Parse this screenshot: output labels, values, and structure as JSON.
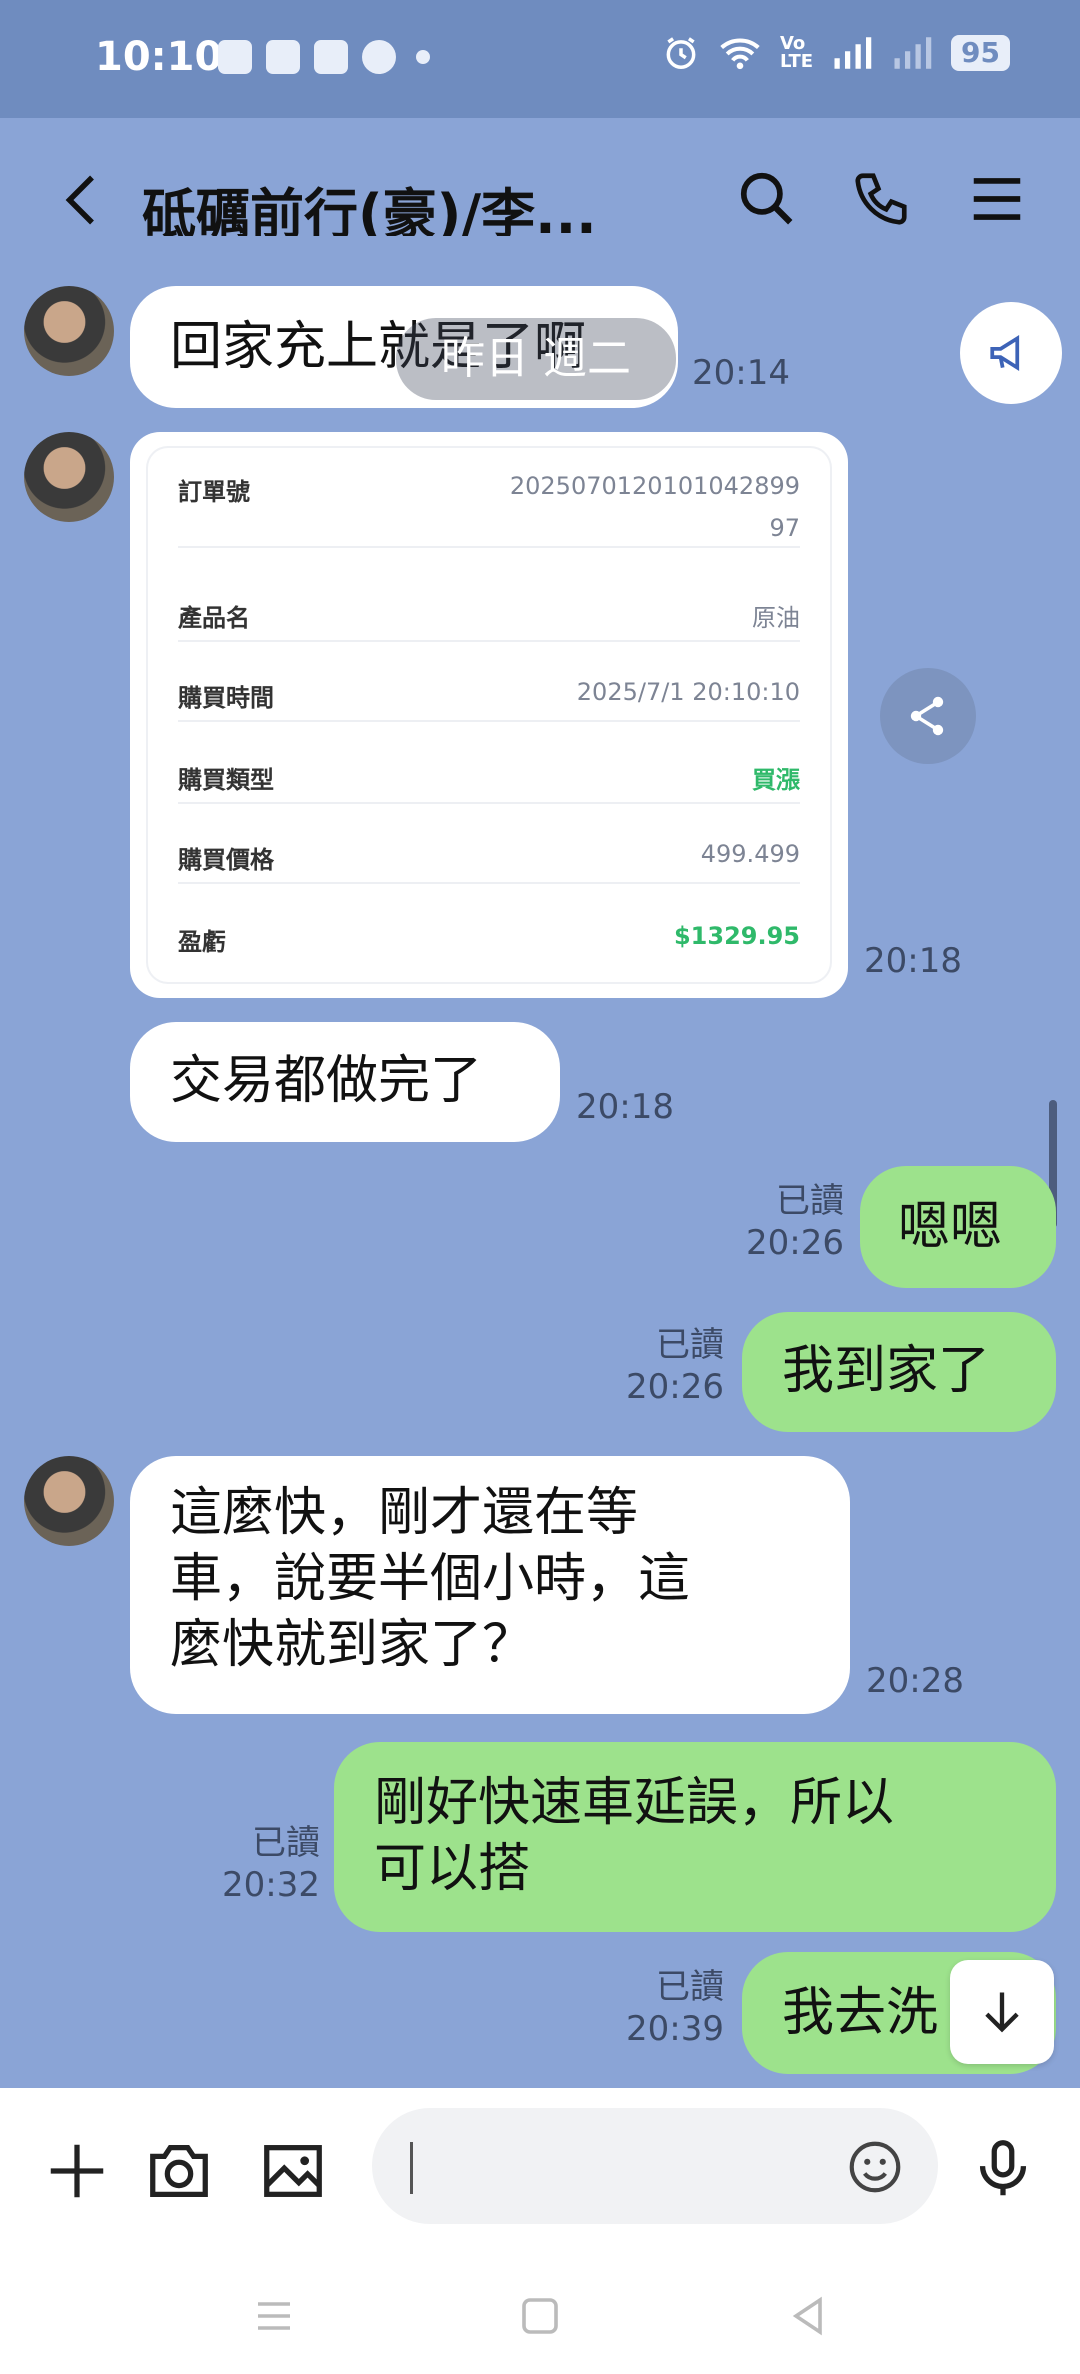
{
  "status": {
    "time": "10:10",
    "volte": "Vo\nLTE",
    "battery": "95"
  },
  "header": {
    "title": "砥礪前行(豪)/李..."
  },
  "messages": [
    {
      "text": "回家充上就是了啊",
      "time": "20:14"
    },
    {
      "time": "20:18"
    },
    {
      "text": "交易都做完了",
      "time": "20:18"
    },
    {
      "text": "嗯嗯",
      "read": "已讀",
      "time": "20:26"
    },
    {
      "text": "我到家了",
      "read": "已讀",
      "time": "20:26"
    },
    {
      "lines": [
        "這麼快，剛才還在等",
        "車，說要半個小時，這",
        "麼快就到家了？"
      ],
      "time": "20:28"
    },
    {
      "lines": [
        "剛好快速車延誤，所以",
        "可以搭"
      ],
      "read": "已讀",
      "time": "20:32"
    },
    {
      "text": "我去洗",
      "read": "已讀",
      "time": "20:39"
    }
  ],
  "order_card": {
    "rows": [
      {
        "label": "訂單號",
        "value": "2025070120101042899",
        "value2": "97"
      },
      {
        "label": "產品名",
        "value": "原油"
      },
      {
        "label": "購買時間",
        "value": "2025/7/1 20:10:10"
      },
      {
        "label": "購買類型",
        "value": "買漲"
      },
      {
        "label": "購買價格",
        "value": "499.499"
      },
      {
        "label": "盈虧",
        "value": "$1329.95"
      }
    ],
    "accent": "#2fb96a"
  },
  "overlay_label": "昨日 週二",
  "icons": {
    "back": "chevron-left-icon",
    "search": "search-icon",
    "call": "phone-icon",
    "menu": "menu-icon",
    "announce": "megaphone-icon",
    "share": "share-icon",
    "down": "arrow-down-icon",
    "plus": "plus-icon",
    "camera": "camera-icon",
    "image": "image-icon",
    "emoji": "emoji-icon",
    "mic": "mic-icon"
  }
}
